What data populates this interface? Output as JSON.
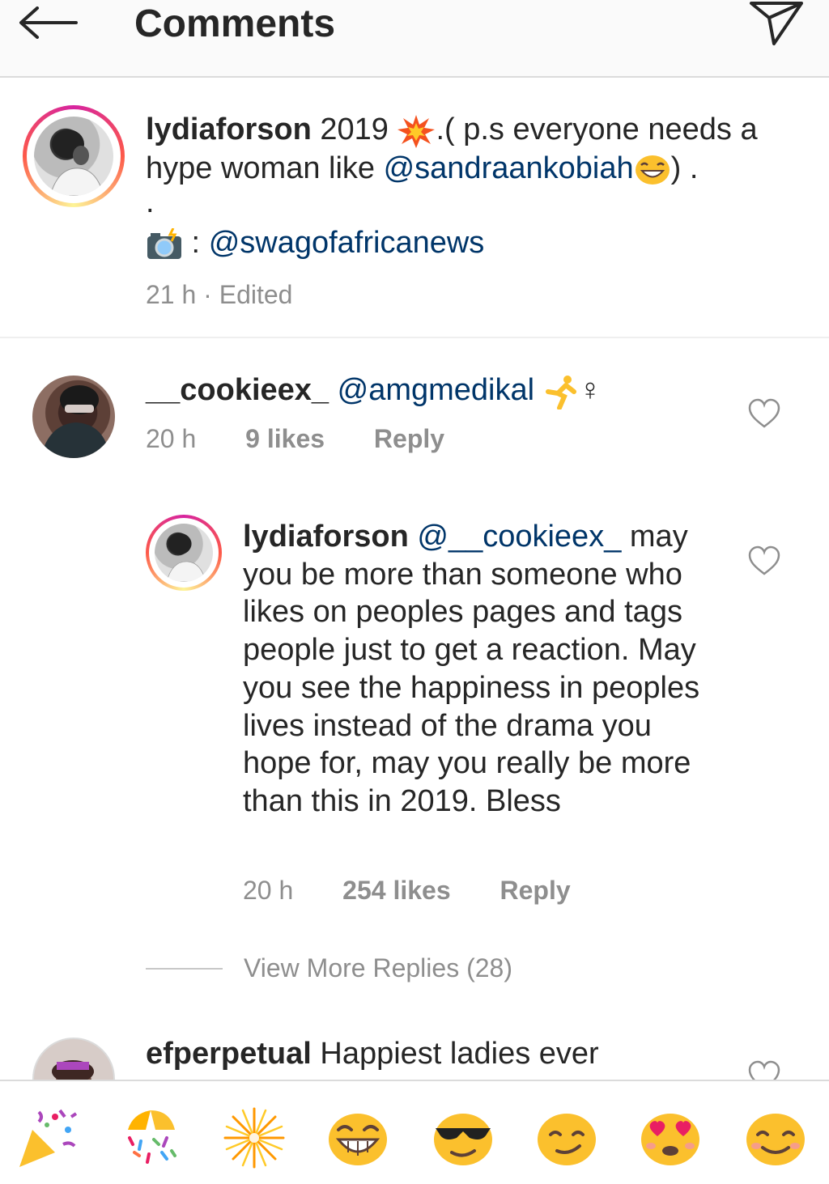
{
  "header": {
    "title": "Comments",
    "back_icon": "arrow-left-icon",
    "send_icon": "paper-plane-icon"
  },
  "caption": {
    "username": "lydiaforson",
    "text_part1": " 2019 ",
    "text_part2": ".( p.s everyone needs a hype woman like ",
    "mention1": "@sandraankobiah",
    "text_part3": ") .",
    "dot_line": ".",
    "camera_sep": " : ",
    "mention2": "@swagofafricanews",
    "meta": "21 h · Edited"
  },
  "comments": [
    {
      "username": "__cookieex_",
      "mention": "@amgmedikal",
      "trail": "‍♀",
      "time": "20 h",
      "likes": "9 likes",
      "reply": "Reply"
    },
    {
      "username": "lydiaforson",
      "mention": "@__cookieex_",
      "text": " may you be more than someone who likes on peoples pages and tags people just to get a reaction. May you see the happiness in peoples lives instead of the drama you hope for, may you really be more than this in 2019. Bless",
      "time": "20 h",
      "likes": "254 likes",
      "reply": "Reply"
    },
    {
      "username": "efperpetual",
      "text": " Happiest ladies ever"
    }
  ],
  "view_more": "View More Replies (28)",
  "emoji_bar": [
    "party-popper",
    "confetti",
    "sparkler",
    "laughing",
    "sunglasses",
    "smirk",
    "heart-eyes",
    "smile"
  ],
  "colors": {
    "mention": "#003569",
    "meta": "#8e8e8e",
    "text": "#262626"
  }
}
